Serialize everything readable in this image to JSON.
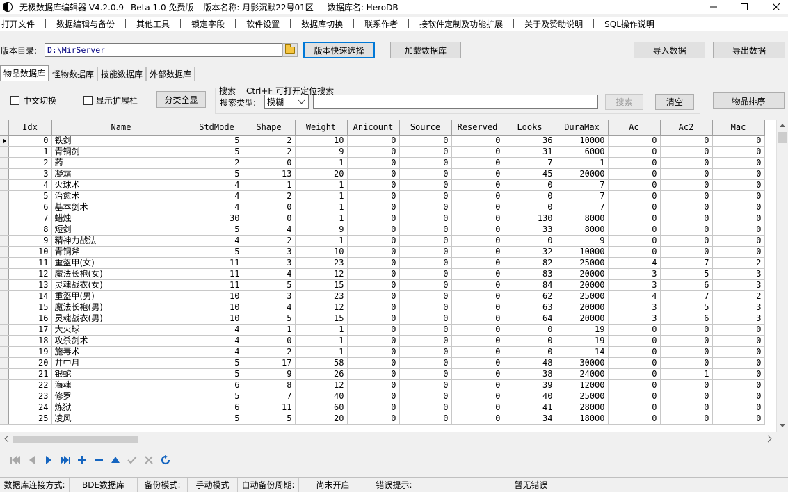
{
  "titlebar": {
    "app_name": "无极数据库编辑器 V4.2.0.9",
    "edition": "Beta 1.0 免费版",
    "version_name": "版本名称: 月影沉默22号01区",
    "db_name": "数据库名: HeroDB"
  },
  "menu": [
    "打开文件",
    "数据编辑与备份",
    "其他工具",
    "锁定字段",
    "软件设置",
    "数据库切换",
    "联系作者",
    "接软件定制及功能扩展",
    "关于及赞助说明",
    "SQL操作说明"
  ],
  "toolbar": {
    "dir_label": "版本目录:",
    "dir_value": "D:\\MirServer",
    "quick_select": "版本快速选择",
    "load_db": "加载数据库",
    "import": "导入数据",
    "export": "导出数据"
  },
  "tabs": [
    "物品数据库",
    "怪物数据库",
    "技能数据库",
    "外部数据库"
  ],
  "filters": {
    "chinese_toggle": "中文切换",
    "show_extension": "显示扩展栏",
    "category_all": "分类全显",
    "search_hint_a": "搜索",
    "search_hint_b": "Ctrl+F 可打开定位搜索",
    "search_type_label": "搜索类型:",
    "search_type_value": "模糊",
    "search_button": "搜索",
    "clear_button": "清空",
    "sort_button": "物品排序"
  },
  "grid": {
    "columns": [
      "Idx",
      "Name",
      "StdMode",
      "Shape",
      "Weight",
      "Anicount",
      "Source",
      "Reserved",
      "Looks",
      "DuraMax",
      "Ac",
      "Ac2",
      "Mac"
    ],
    "rows": [
      [
        "0",
        "铁剑",
        "5",
        "2",
        "10",
        "0",
        "0",
        "0",
        "36",
        "10000",
        "0",
        "0",
        "0"
      ],
      [
        "1",
        "青铜剑",
        "5",
        "2",
        "9",
        "0",
        "0",
        "0",
        "31",
        "6000",
        "0",
        "0",
        "0"
      ],
      [
        "2",
        "药",
        "2",
        "0",
        "1",
        "0",
        "0",
        "0",
        "7",
        "1",
        "0",
        "0",
        "0"
      ],
      [
        "3",
        "凝霜",
        "5",
        "13",
        "20",
        "0",
        "0",
        "0",
        "45",
        "20000",
        "0",
        "0",
        "0"
      ],
      [
        "4",
        "火球术",
        "4",
        "1",
        "1",
        "0",
        "0",
        "0",
        "0",
        "7",
        "0",
        "0",
        "0"
      ],
      [
        "5",
        "治愈术",
        "4",
        "2",
        "1",
        "0",
        "0",
        "0",
        "0",
        "7",
        "0",
        "0",
        "0"
      ],
      [
        "6",
        "基本剑术",
        "4",
        "0",
        "1",
        "0",
        "0",
        "0",
        "0",
        "7",
        "0",
        "0",
        "0"
      ],
      [
        "7",
        "蜡烛",
        "30",
        "0",
        "1",
        "0",
        "0",
        "0",
        "130",
        "8000",
        "0",
        "0",
        "0"
      ],
      [
        "8",
        "短剑",
        "5",
        "4",
        "9",
        "0",
        "0",
        "0",
        "33",
        "8000",
        "0",
        "0",
        "0"
      ],
      [
        "9",
        "精神力战法",
        "4",
        "2",
        "1",
        "0",
        "0",
        "0",
        "0",
        "9",
        "0",
        "0",
        "0"
      ],
      [
        "10",
        "青铜斧",
        "5",
        "3",
        "10",
        "0",
        "0",
        "0",
        "32",
        "10000",
        "0",
        "0",
        "0"
      ],
      [
        "11",
        "重盔甲(女)",
        "11",
        "3",
        "23",
        "0",
        "0",
        "0",
        "82",
        "25000",
        "4",
        "7",
        "2"
      ],
      [
        "12",
        "魔法长袍(女)",
        "11",
        "4",
        "12",
        "0",
        "0",
        "0",
        "83",
        "20000",
        "3",
        "5",
        "3"
      ],
      [
        "13",
        "灵魂战衣(女)",
        "11",
        "5",
        "15",
        "0",
        "0",
        "0",
        "84",
        "20000",
        "3",
        "6",
        "3"
      ],
      [
        "14",
        "重盔甲(男)",
        "10",
        "3",
        "23",
        "0",
        "0",
        "0",
        "62",
        "25000",
        "4",
        "7",
        "2"
      ],
      [
        "15",
        "魔法长袍(男)",
        "10",
        "4",
        "12",
        "0",
        "0",
        "0",
        "63",
        "20000",
        "3",
        "5",
        "3"
      ],
      [
        "16",
        "灵魂战衣(男)",
        "10",
        "5",
        "15",
        "0",
        "0",
        "0",
        "64",
        "20000",
        "3",
        "6",
        "3"
      ],
      [
        "17",
        "大火球",
        "4",
        "1",
        "1",
        "0",
        "0",
        "0",
        "0",
        "19",
        "0",
        "0",
        "0"
      ],
      [
        "18",
        "攻杀剑术",
        "4",
        "0",
        "1",
        "0",
        "0",
        "0",
        "0",
        "19",
        "0",
        "0",
        "0"
      ],
      [
        "19",
        "施毒术",
        "4",
        "2",
        "1",
        "0",
        "0",
        "0",
        "0",
        "14",
        "0",
        "0",
        "0"
      ],
      [
        "20",
        "井中月",
        "5",
        "17",
        "58",
        "0",
        "0",
        "0",
        "48",
        "30000",
        "0",
        "0",
        "0"
      ],
      [
        "21",
        "银蛇",
        "5",
        "9",
        "26",
        "0",
        "0",
        "0",
        "38",
        "24000",
        "0",
        "1",
        "0"
      ],
      [
        "22",
        "海魂",
        "6",
        "8",
        "12",
        "0",
        "0",
        "0",
        "39",
        "12000",
        "0",
        "0",
        "0"
      ],
      [
        "23",
        "修罗",
        "5",
        "7",
        "40",
        "0",
        "0",
        "0",
        "40",
        "25000",
        "0",
        "0",
        "0"
      ],
      [
        "24",
        "炼狱",
        "6",
        "11",
        "60",
        "0",
        "0",
        "0",
        "41",
        "28000",
        "0",
        "0",
        "0"
      ],
      [
        "25",
        "凌风",
        "5",
        "5",
        "20",
        "0",
        "0",
        "0",
        "34",
        "18000",
        "0",
        "0",
        "0"
      ]
    ]
  },
  "statusbar": {
    "conn_label": "数据库连接方式:",
    "conn_value": "BDE数据库",
    "backup_label": "备份模式:",
    "backup_value": "手动模式",
    "auto_label": "自动备份周期:",
    "auto_value": "尚未开启",
    "err_label": "错误提示:",
    "err_value": "暂无错误"
  },
  "icons": {
    "nav_first": "first-record-icon",
    "nav_prior": "prior-record-icon",
    "nav_next": "next-record-icon",
    "nav_last": "last-record-icon",
    "nav_insert": "insert-record-icon",
    "nav_delete": "delete-record-icon",
    "nav_edit": "edit-record-icon",
    "nav_post": "post-record-icon",
    "nav_cancel": "cancel-record-icon",
    "nav_refresh": "refresh-icon"
  },
  "colors": {
    "accent": "#0078d7",
    "nav_blue": "#1565c0",
    "nav_gray": "#a8a8a8"
  }
}
